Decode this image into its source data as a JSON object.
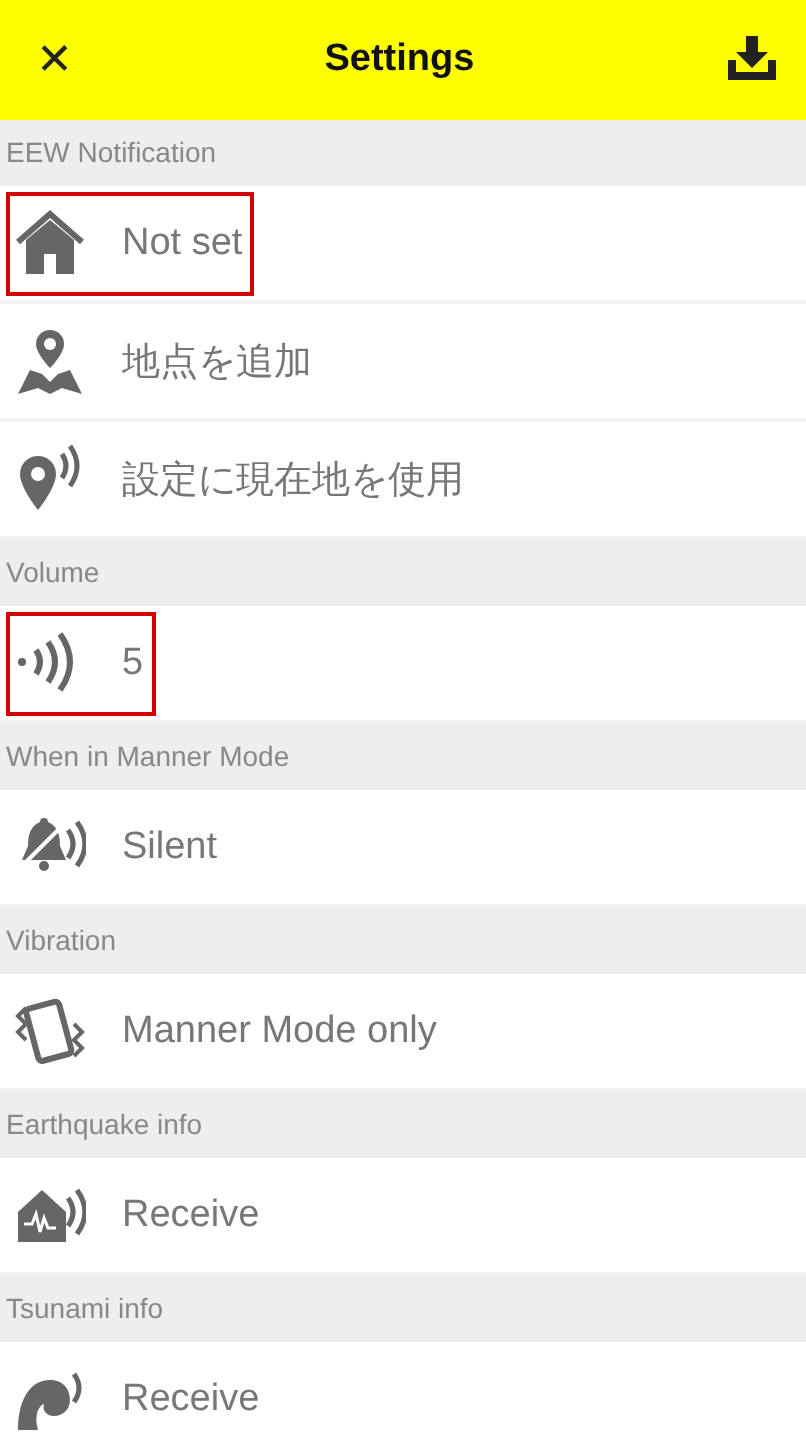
{
  "header": {
    "close": "✕",
    "title": "Settings"
  },
  "sections": [
    {
      "title": "EEW Notification",
      "rows": [
        {
          "kind": "home",
          "label": "Not set",
          "highlighted": true
        },
        {
          "kind": "map",
          "label": "地点を追加",
          "highlighted": false
        },
        {
          "kind": "locate",
          "label": "設定に現在地を使用",
          "highlighted": false
        }
      ]
    },
    {
      "title": "Volume",
      "rows": [
        {
          "kind": "sound",
          "label": "5",
          "highlighted": true
        }
      ]
    },
    {
      "title": "When in Manner Mode",
      "rows": [
        {
          "kind": "silent",
          "label": "Silent",
          "highlighted": false
        }
      ]
    },
    {
      "title": "Vibration",
      "rows": [
        {
          "kind": "vibrate",
          "label": "Manner Mode only",
          "highlighted": false
        }
      ]
    },
    {
      "title": "Earthquake info",
      "rows": [
        {
          "kind": "quake",
          "label": "Receive",
          "highlighted": false
        }
      ]
    },
    {
      "title": "Tsunami info",
      "rows": [
        {
          "kind": "tsunami",
          "label": "Receive",
          "highlighted": false
        }
      ]
    }
  ]
}
